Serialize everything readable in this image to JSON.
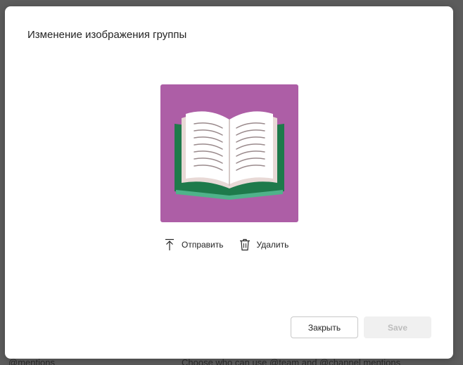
{
  "background": {
    "left_text": "@mentions",
    "right_text": "Choose who can use @team and @channel mentions"
  },
  "dialog": {
    "title": "Изменение изображения группы",
    "image": {
      "icon": "open-book-icon",
      "background_color": "#ad5ea6"
    },
    "actions": {
      "upload_label": "Отправить",
      "upload_icon": "upload-icon",
      "delete_label": "Удалить",
      "delete_icon": "trash-icon"
    },
    "buttons": {
      "close_label": "Закрыть",
      "save_label": "Save"
    }
  }
}
